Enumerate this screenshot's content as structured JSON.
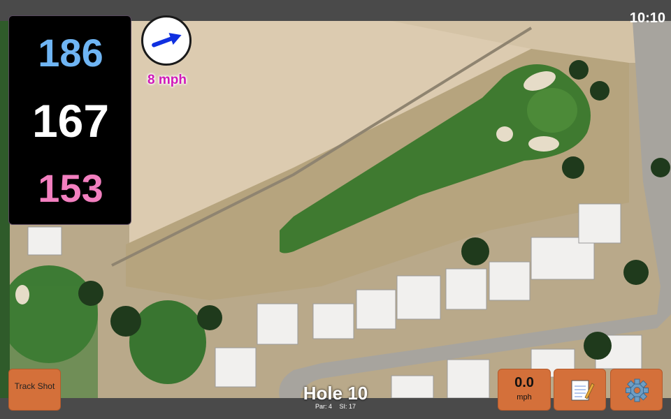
{
  "status_bar": {
    "time": "10:10"
  },
  "distances": {
    "back": "186",
    "middle": "167",
    "front": "153"
  },
  "wind": {
    "speed_label": "8 mph",
    "arrow_icon": "arrow-right-icon",
    "direction": "east-northeast"
  },
  "hole": {
    "title": "Hole 10",
    "par": "Par: 4",
    "stroke_index": "SI: 17"
  },
  "buttons": {
    "track_shot": "Track Shot",
    "wind_value": "0.0",
    "wind_unit": "mph",
    "notes_icon": "notepad-icon",
    "settings_icon": "gear-icon"
  },
  "colors": {
    "back_distance": "#6fb5f4",
    "middle_distance": "#ffffff",
    "front_distance": "#f27fbf",
    "button": "#d4703a",
    "wind_label": "#d018b8"
  }
}
